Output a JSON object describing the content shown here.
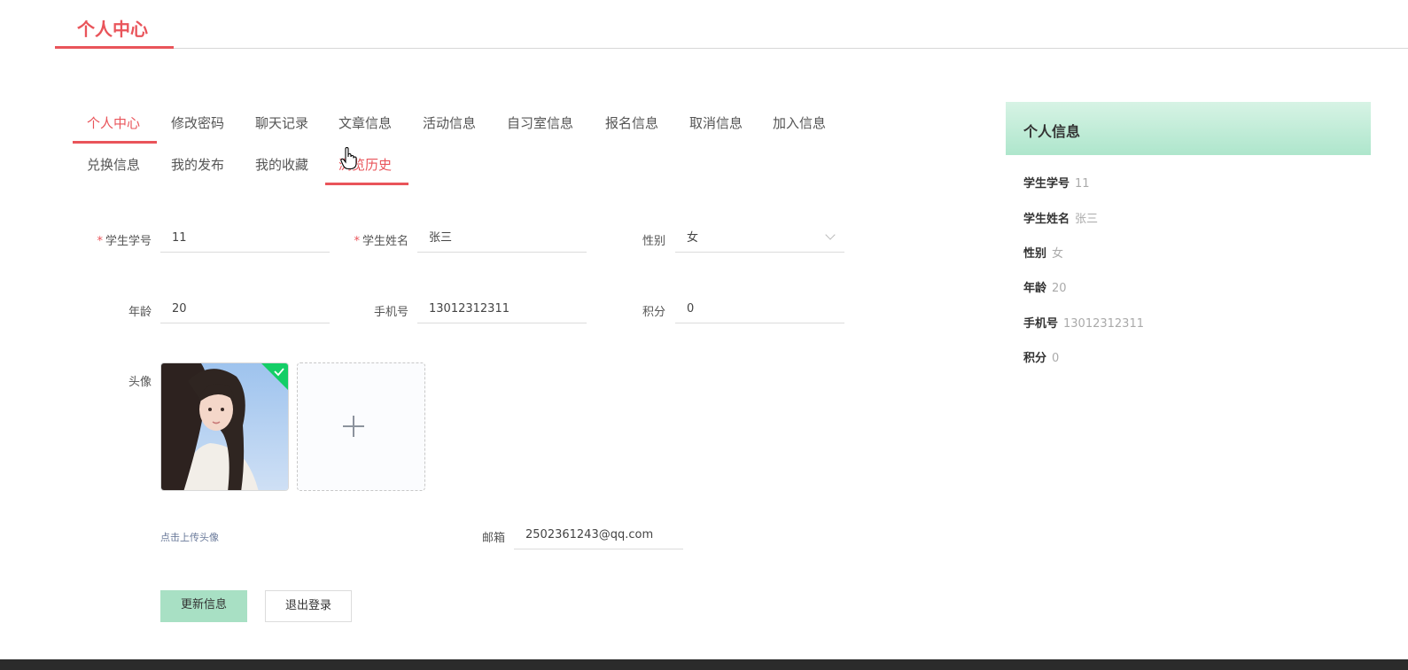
{
  "header": {
    "title": "个人中心"
  },
  "tabs": [
    {
      "label": "个人中心"
    },
    {
      "label": "修改密码"
    },
    {
      "label": "聊天记录"
    },
    {
      "label": "文章信息"
    },
    {
      "label": "活动信息"
    },
    {
      "label": "自习室信息"
    },
    {
      "label": "报名信息"
    },
    {
      "label": "取消信息"
    },
    {
      "label": "加入信息"
    },
    {
      "label": "兑换信息"
    },
    {
      "label": "我的发布"
    },
    {
      "label": "我的收藏"
    },
    {
      "label": "浏览历史"
    }
  ],
  "form": {
    "student_id": {
      "label": "学生学号",
      "value": "11"
    },
    "student_name": {
      "label": "学生姓名",
      "value": "张三"
    },
    "gender": {
      "label": "性别",
      "value": "女"
    },
    "age": {
      "label": "年龄",
      "value": "20"
    },
    "phone": {
      "label": "手机号",
      "value": "13012312311"
    },
    "points": {
      "label": "积分",
      "value": "0"
    },
    "avatar": {
      "label": "头像",
      "upload_hint": "点击上传头像"
    },
    "email": {
      "label": "邮箱",
      "value": "2502361243@qq.com"
    },
    "required_mark": "*"
  },
  "buttons": {
    "update": "更新信息",
    "logout": "退出登录"
  },
  "panel": {
    "title": "个人信息",
    "rows": [
      {
        "key": "学生学号",
        "value": "11"
      },
      {
        "key": "学生姓名",
        "value": "张三"
      },
      {
        "key": "性别",
        "value": "女"
      },
      {
        "key": "年龄",
        "value": "20"
      },
      {
        "key": "手机号",
        "value": "13012312311"
      },
      {
        "key": "积分",
        "value": "0"
      }
    ]
  },
  "colors": {
    "accent": "#e9545a",
    "success": "#13ce66",
    "primary_button": "#a8e0c4"
  },
  "icons": {
    "avatar_status": "check-icon",
    "upload": "plus-icon",
    "select": "chevron-down-icon",
    "cursor": "hand-pointer-icon"
  }
}
